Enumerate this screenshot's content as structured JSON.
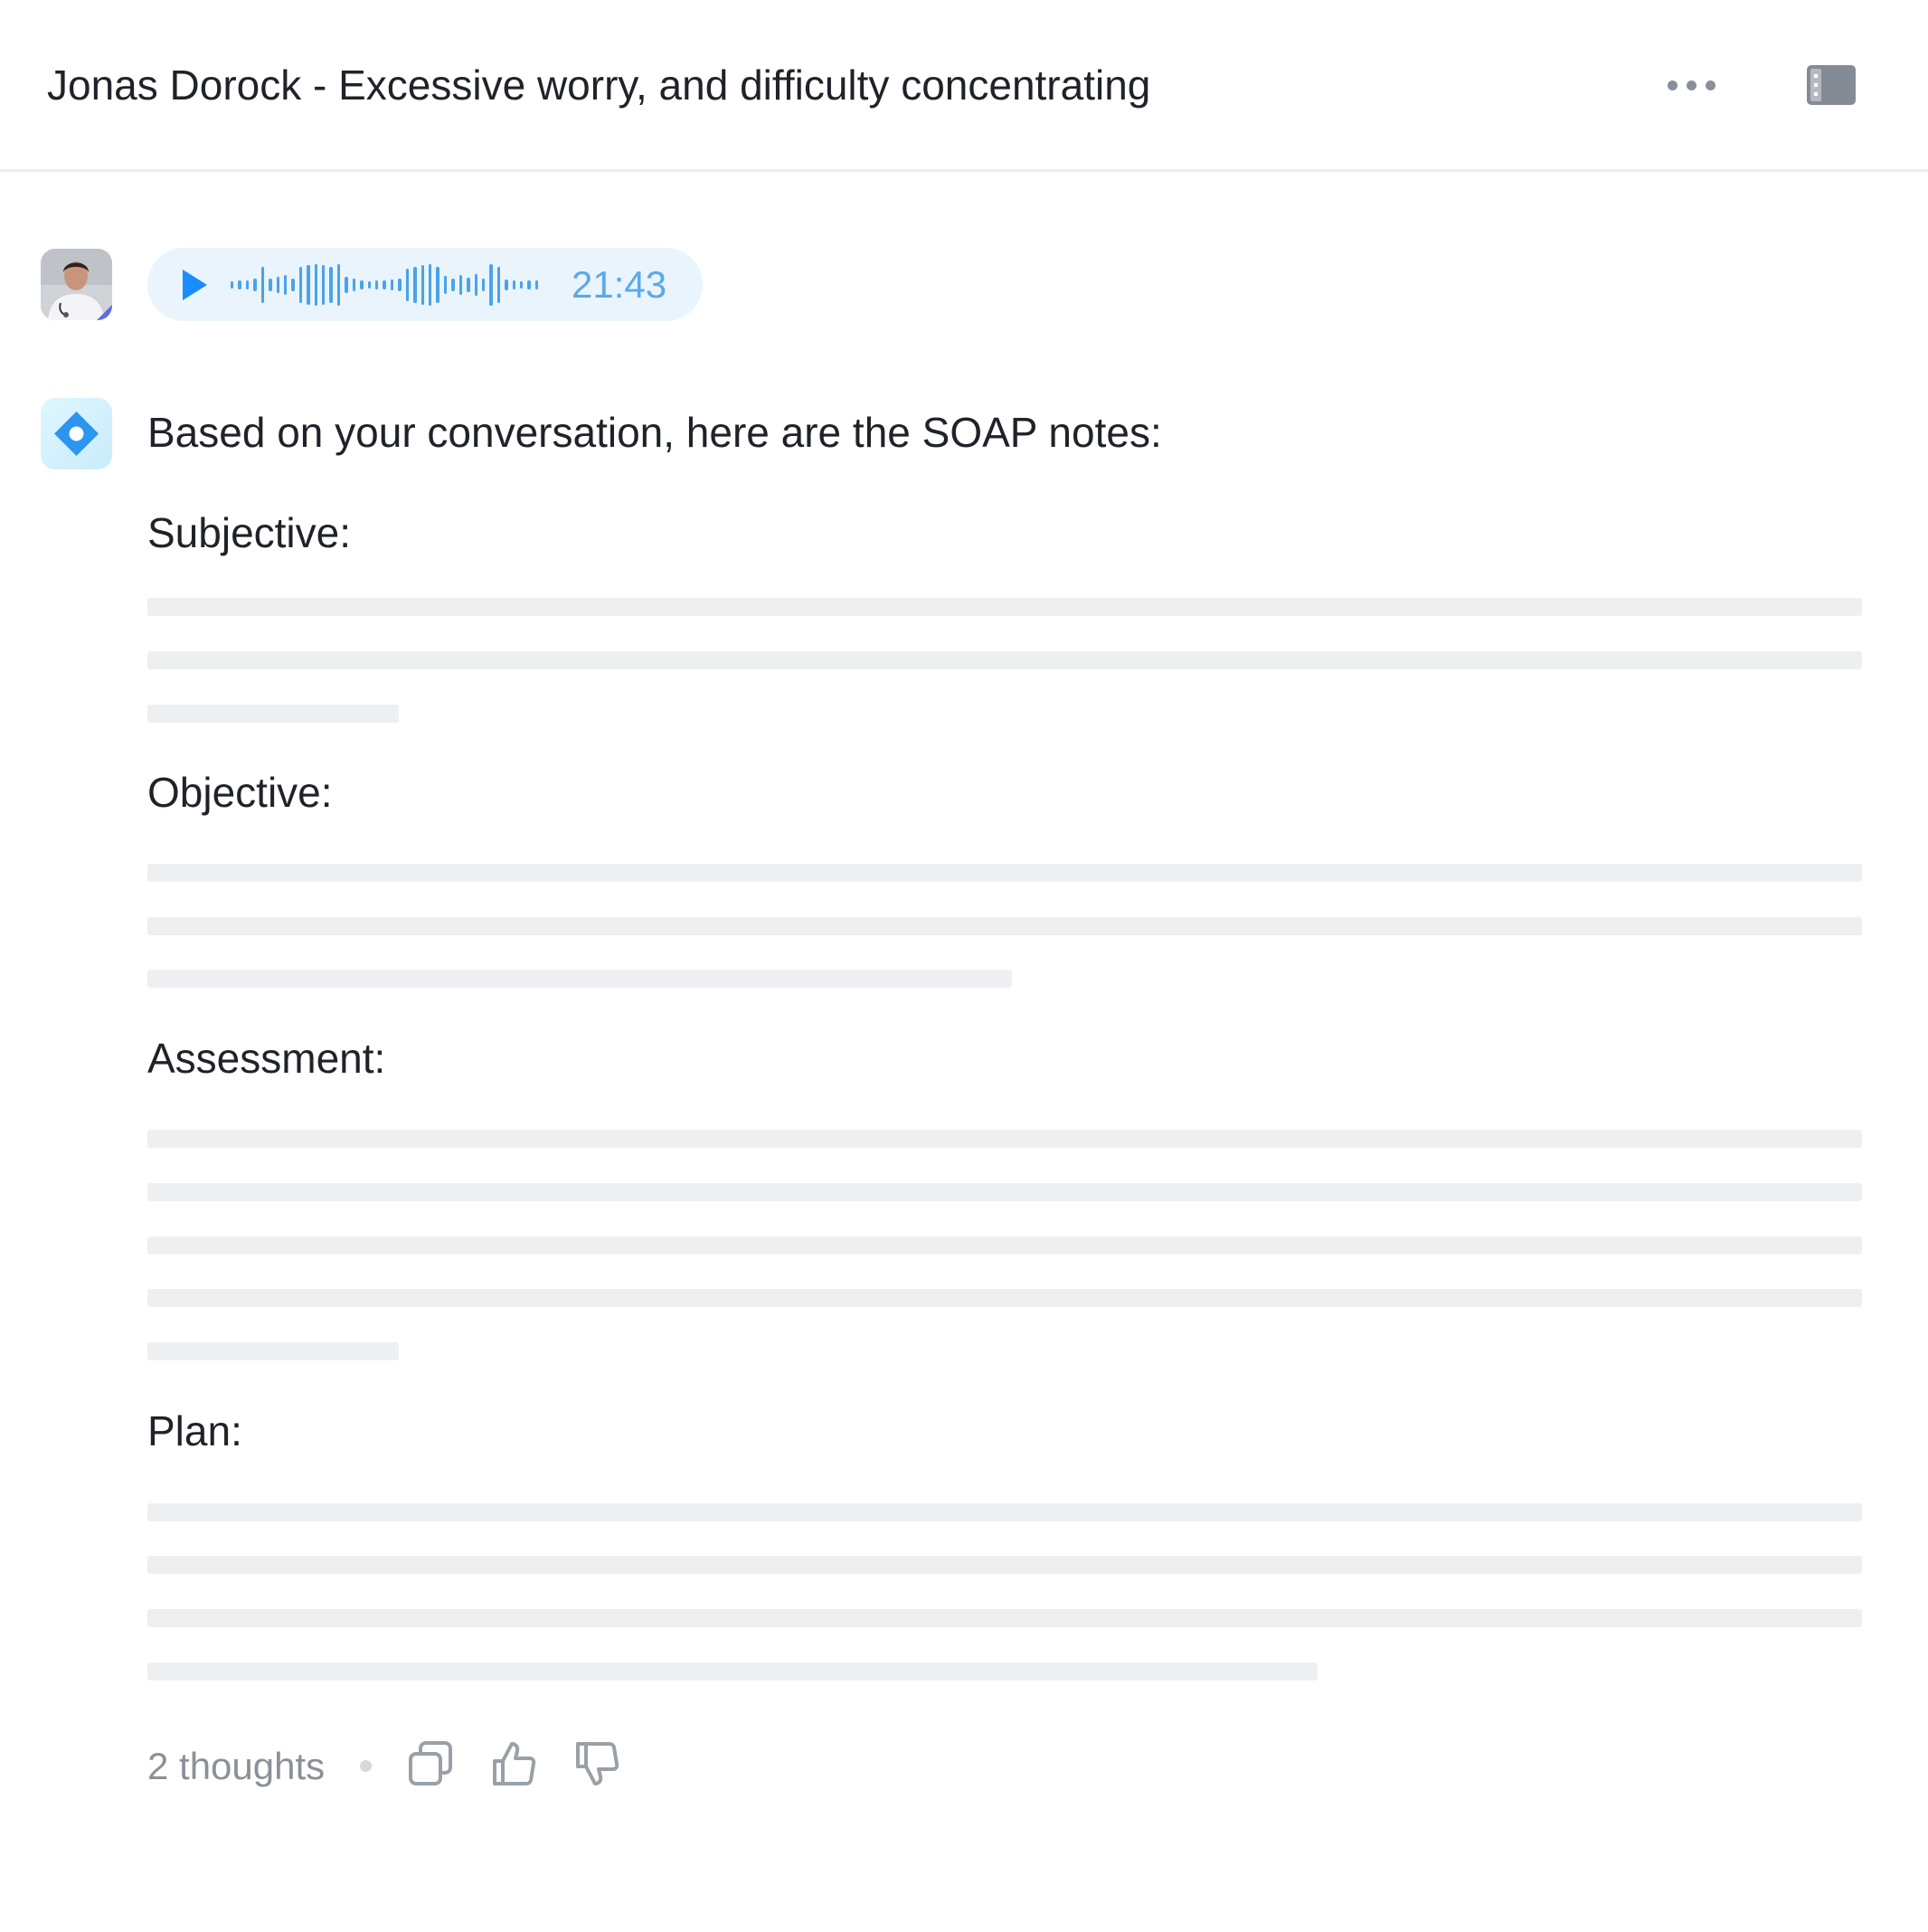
{
  "header": {
    "title": "Jonas Dorock - Excessive worry, and difficulty concentrating",
    "more_icon": "more-horizontal-icon",
    "panel_icon": "sidebar-toggle-icon"
  },
  "audio_message": {
    "duration": "21:43",
    "play_icon": "play-icon",
    "accent_color": "#1a8cff"
  },
  "assistant_message": {
    "intro": "Based on your conversation, here are the SOAP notes:",
    "sections": [
      {
        "heading": "Subjective:"
      },
      {
        "heading": "Objective:"
      },
      {
        "heading": "Assessment:"
      },
      {
        "heading": "Plan:"
      }
    ]
  },
  "footer": {
    "thoughts": "2 thoughts",
    "copy_icon": "copy-icon",
    "like_icon": "thumbs-up-icon",
    "dislike_icon": "thumbs-down-icon"
  },
  "colors": {
    "text": "#1f2329",
    "muted": "#8b9098",
    "skeleton": "#eeeff1",
    "audio_bg": "#eaf4fd",
    "waveform": "#4aa3e8"
  }
}
